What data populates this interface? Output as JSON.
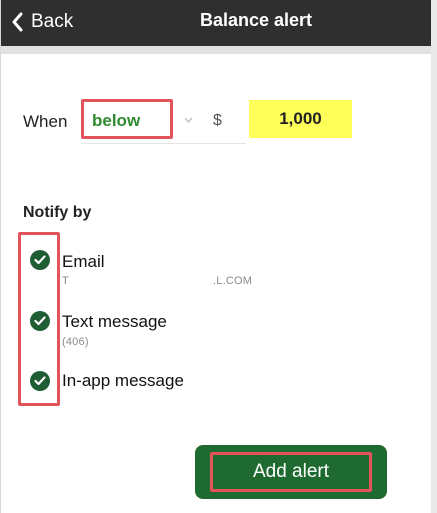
{
  "header": {
    "back_label": "Back",
    "title": "Balance alert",
    "back_icon": "chevron-left-icon"
  },
  "condition": {
    "when_label": "When",
    "selected_option": "below",
    "currency_symbol": "$",
    "amount": "1,000"
  },
  "notify": {
    "title": "Notify by",
    "options": [
      {
        "label": "Email",
        "sublabel_start": "T",
        "sublabel_end": ".L.COM",
        "checked": true
      },
      {
        "label": "Text message",
        "sublabel": "(406)",
        "checked": true
      },
      {
        "label": "In-app message",
        "checked": true
      }
    ]
  },
  "actions": {
    "add_label": "Add alert"
  },
  "colors": {
    "header_bg": "#2f2f2f",
    "accent_green": "#2f8a2f",
    "check_green": "#1f5d34",
    "button_green": "#1e6a31",
    "highlight_red": "#e2545b",
    "amount_highlight": "#ffff5a"
  }
}
